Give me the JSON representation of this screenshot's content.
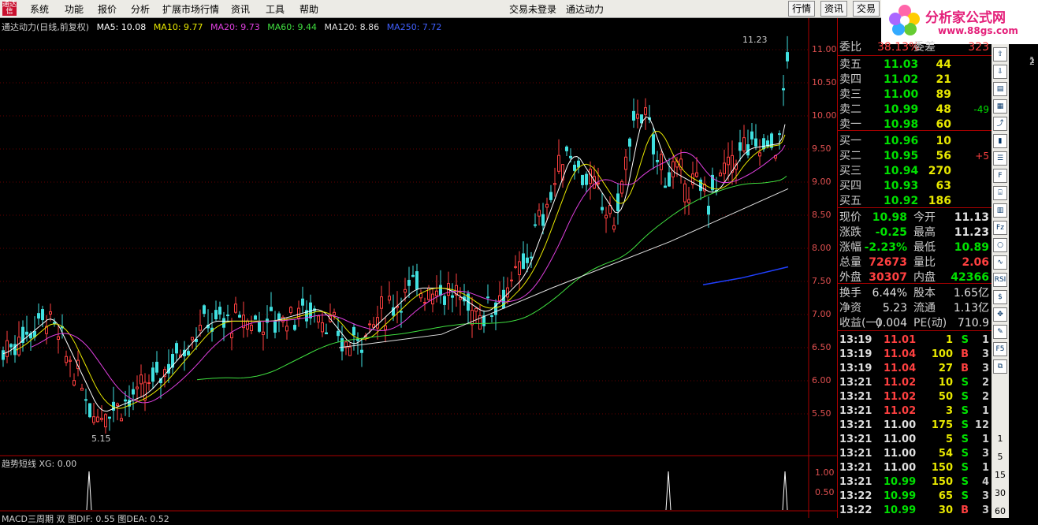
{
  "menu": {
    "items": [
      "系统",
      "功能",
      "报价",
      "分析",
      "扩展市场行情",
      "资讯",
      "工具",
      "帮助"
    ],
    "status": "交易未登录",
    "stock_title": "通达动力",
    "tab_buttons": [
      "行情",
      "资讯",
      "交易"
    ]
  },
  "watermark": {
    "title": "分析家公式网",
    "url": "www.88gs.com"
  },
  "chart_title": {
    "name": "通达动力(日线,前复权)",
    "ma5": "MA5: 10.08",
    "ma10": "MA10: 9.77",
    "ma20": "MA20: 9.73",
    "ma60": "MA60: 9.44",
    "ma120": "MA120: 8.86",
    "ma250": "MA250: 7.72"
  },
  "colors": {
    "ma5": "#ffffff",
    "ma10": "#e8e800",
    "ma20": "#e040e0",
    "ma60": "#40e040",
    "ma120": "#e0e0e0",
    "ma250": "#2040ff",
    "up": "#ff4040",
    "down": "#40e0e0"
  },
  "price_axis": [
    "11.00",
    "10.50",
    "10.00",
    "9.50",
    "9.00",
    "8.50",
    "8.00",
    "7.50",
    "7.00",
    "6.50",
    "6.00",
    "5.50"
  ],
  "annotations": {
    "high": "11.23",
    "low": "5.15"
  },
  "indicator": {
    "title": "趋势短线 XG: 0.00",
    "ticks": [
      "1.00",
      "0.50"
    ]
  },
  "macd": {
    "title": "MACD三周期 双  图DIF: 0.55  图DEA: 0.52"
  },
  "quote": {
    "weibi": {
      "label": "委比",
      "value": "38.13%",
      "label2": "委差",
      "value2": "323"
    },
    "sell": [
      {
        "label": "卖五",
        "price": "11.03",
        "vol": "44",
        "chg": ""
      },
      {
        "label": "卖四",
        "price": "11.02",
        "vol": "21",
        "chg": ""
      },
      {
        "label": "卖三",
        "price": "11.00",
        "vol": "89",
        "chg": ""
      },
      {
        "label": "卖二",
        "price": "10.99",
        "vol": "48",
        "chg": "-49"
      },
      {
        "label": "卖一",
        "price": "10.98",
        "vol": "60",
        "chg": ""
      }
    ],
    "buy": [
      {
        "label": "买一",
        "price": "10.96",
        "vol": "10",
        "chg": ""
      },
      {
        "label": "买二",
        "price": "10.95",
        "vol": "56",
        "chg": "+5"
      },
      {
        "label": "买三",
        "price": "10.94",
        "vol": "270",
        "chg": ""
      },
      {
        "label": "买四",
        "price": "10.93",
        "vol": "63",
        "chg": ""
      },
      {
        "label": "买五",
        "price": "10.92",
        "vol": "186",
        "chg": ""
      }
    ],
    "stats": [
      {
        "l1": "现价",
        "v1": "10.98",
        "l2": "今开",
        "v2": "11.13"
      },
      {
        "l1": "涨跌",
        "v1": "-0.25",
        "l2": "最高",
        "v2": "11.23"
      },
      {
        "l1": "涨幅",
        "v1": "-2.23%",
        "l2": "最低",
        "v2": "10.89"
      },
      {
        "l1": "总量",
        "v1": "72673",
        "l2": "量比",
        "v2": "2.06"
      },
      {
        "l1": "外盘",
        "v1": "30307",
        "l2": "内盘",
        "v2": "42366"
      }
    ],
    "stats2": [
      {
        "l1": "换手",
        "v1": "6.44%",
        "l2": "股本",
        "v2": "1.65亿"
      },
      {
        "l1": "净资",
        "v1": "5.23",
        "l2": "流通",
        "v2": "1.13亿"
      },
      {
        "l1": "收益(一)",
        "v1": "0.004",
        "l2": "PE(动)",
        "v2": "710.9"
      }
    ],
    "ticks": [
      {
        "t": "13:19",
        "p": "11.01",
        "q": "1",
        "s": "S",
        "n": "1"
      },
      {
        "t": "13:19",
        "p": "11.04",
        "q": "100",
        "s": "B",
        "n": "3"
      },
      {
        "t": "13:19",
        "p": "11.04",
        "q": "27",
        "s": "B",
        "n": "3"
      },
      {
        "t": "13:21",
        "p": "11.02",
        "q": "10",
        "s": "S",
        "n": "2"
      },
      {
        "t": "13:21",
        "p": "11.02",
        "q": "50",
        "s": "S",
        "n": "2"
      },
      {
        "t": "13:21",
        "p": "11.02",
        "q": "3",
        "s": "S",
        "n": "1"
      },
      {
        "t": "13:21",
        "p": "11.00",
        "q": "175",
        "s": "S",
        "n": "12"
      },
      {
        "t": "13:21",
        "p": "11.00",
        "q": "5",
        "s": "S",
        "n": "1"
      },
      {
        "t": "13:21",
        "p": "11.00",
        "q": "54",
        "s": "S",
        "n": "3"
      },
      {
        "t": "13:21",
        "p": "11.00",
        "q": "150",
        "s": "S",
        "n": "1"
      },
      {
        "t": "13:21",
        "p": "10.99",
        "q": "150",
        "s": "S",
        "n": "4"
      },
      {
        "t": "13:22",
        "p": "10.99",
        "q": "65",
        "s": "S",
        "n": "3"
      },
      {
        "t": "13:22",
        "p": "10.99",
        "q": "30",
        "s": "B",
        "n": "3"
      }
    ]
  },
  "toolbar_nums": [
    "1",
    "5",
    "15",
    "30",
    "60"
  ],
  "farright_nums": [
    "1",
    "2"
  ]
}
